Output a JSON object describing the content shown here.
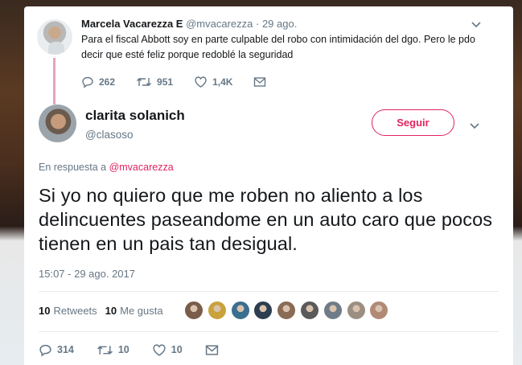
{
  "parent_tweet": {
    "name": "Marcela Vacarezza E",
    "handle": "@mvacarezza",
    "date": "· 29 ago.",
    "text": "Para el fiscal Abbott soy en parte culpable del robo con intimidación del dgo. Pero le pdo decir que esté feliz porque redoblé la seguridad",
    "replies": "262",
    "retweets": "951",
    "likes": "1,4K"
  },
  "tweet": {
    "name": "clarita solanich",
    "handle": "@clasoso",
    "follow_label": "Seguir",
    "reply_prefix": "En respuesta a",
    "reply_mention": "@mvacarezza",
    "text": "Si yo no quiero que me roben no aliento a los delincuentes paseandome en un auto caro que pocos tienen en un pais tan desigual.",
    "timestamp": "15:07 - 29 ago. 2017",
    "retweets_count": "10",
    "retweets_label": "Retweets",
    "likes_count": "10",
    "likes_label": "Me gusta",
    "replies": "314",
    "retweets": "10",
    "likes": "10"
  },
  "colors": {
    "accent": "#e0245e",
    "text": "#14171a",
    "muted": "#657786",
    "thread": "#e3a3bf"
  },
  "liker_avatars": [
    "#7a5c4a",
    "#c9a23a",
    "#3b6f8f",
    "#2c3e50",
    "#8a6b55",
    "#5a5a5a",
    "#6e7b88",
    "#9a8f80",
    "#b08a76"
  ]
}
